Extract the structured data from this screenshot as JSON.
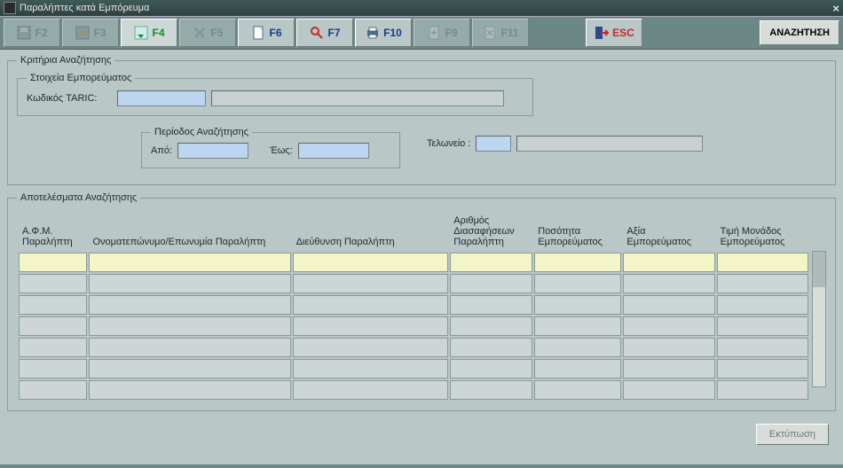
{
  "window": {
    "title": "Παραλήπτες κατά Εμπόρευμα"
  },
  "toolbar": {
    "f2": "F2",
    "f3": "F3",
    "f4": "F4",
    "f5": "F5",
    "f6": "F6",
    "f7": "F7",
    "f10": "F10",
    "f9": "F9",
    "f11": "F11",
    "esc": "ESC",
    "search": "ΑΝΑΖΗΤΗΣΗ"
  },
  "criteria": {
    "legend": "Κριτήρια Αναζήτησης",
    "goods_legend": "Στοιχεία Εμπορεύματος",
    "taric_label": "Κωδικός TARIC:",
    "taric_code": "",
    "taric_desc": "",
    "period_legend": "Περίοδος Αναζήτησης",
    "from_label": "Από:",
    "to_label": "Έως:",
    "from_value": "",
    "to_value": "",
    "customs_label": "Τελωνείο :",
    "customs_code": "",
    "customs_desc": ""
  },
  "results": {
    "legend": "Αποτελέσματα Αναζήτησης",
    "columns": {
      "afm": "Α.Φ.Μ. Παραλήπτη",
      "name": "Ονοματεπώνυμο/Επωνυμία Παραλήπτη",
      "address": "Διεύθυνση Παραλήπτη",
      "decl_count": "Αριθμός Διασαφήσεων Παραλήπτη",
      "quantity": "Ποσότητα Εμπορεύματος",
      "value": "Αξία Εμπορεύματος",
      "unit_price": "Τιμή Μονάδος Εμπορεύματος"
    },
    "rows": [
      {
        "afm": "",
        "name": "",
        "address": "",
        "decl_count": "",
        "quantity": "",
        "value": "",
        "unit_price": ""
      },
      {
        "afm": "",
        "name": "",
        "address": "",
        "decl_count": "",
        "quantity": "",
        "value": "",
        "unit_price": ""
      },
      {
        "afm": "",
        "name": "",
        "address": "",
        "decl_count": "",
        "quantity": "",
        "value": "",
        "unit_price": ""
      },
      {
        "afm": "",
        "name": "",
        "address": "",
        "decl_count": "",
        "quantity": "",
        "value": "",
        "unit_price": ""
      },
      {
        "afm": "",
        "name": "",
        "address": "",
        "decl_count": "",
        "quantity": "",
        "value": "",
        "unit_price": ""
      },
      {
        "afm": "",
        "name": "",
        "address": "",
        "decl_count": "",
        "quantity": "",
        "value": "",
        "unit_price": ""
      },
      {
        "afm": "",
        "name": "",
        "address": "",
        "decl_count": "",
        "quantity": "",
        "value": "",
        "unit_price": ""
      }
    ],
    "print": "Εκτύπωση"
  }
}
